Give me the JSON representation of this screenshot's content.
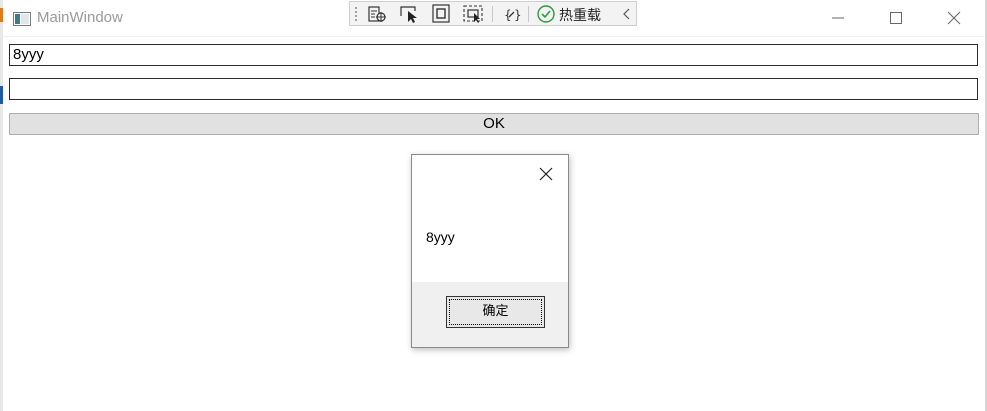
{
  "window": {
    "title": "MainWindow"
  },
  "devtoolbar": {
    "hot_reload_label": "热重载"
  },
  "form": {
    "input1_value": "8yyy",
    "input2_value": "",
    "ok_label": "OK"
  },
  "messagebox": {
    "text": "8yyy",
    "confirm_label": "确定"
  },
  "colors": {
    "hot_reload_check": "#2e9b3c",
    "edge_mark_orange": "#e07a1f",
    "edge_mark_blue": "#1e5aa8"
  }
}
